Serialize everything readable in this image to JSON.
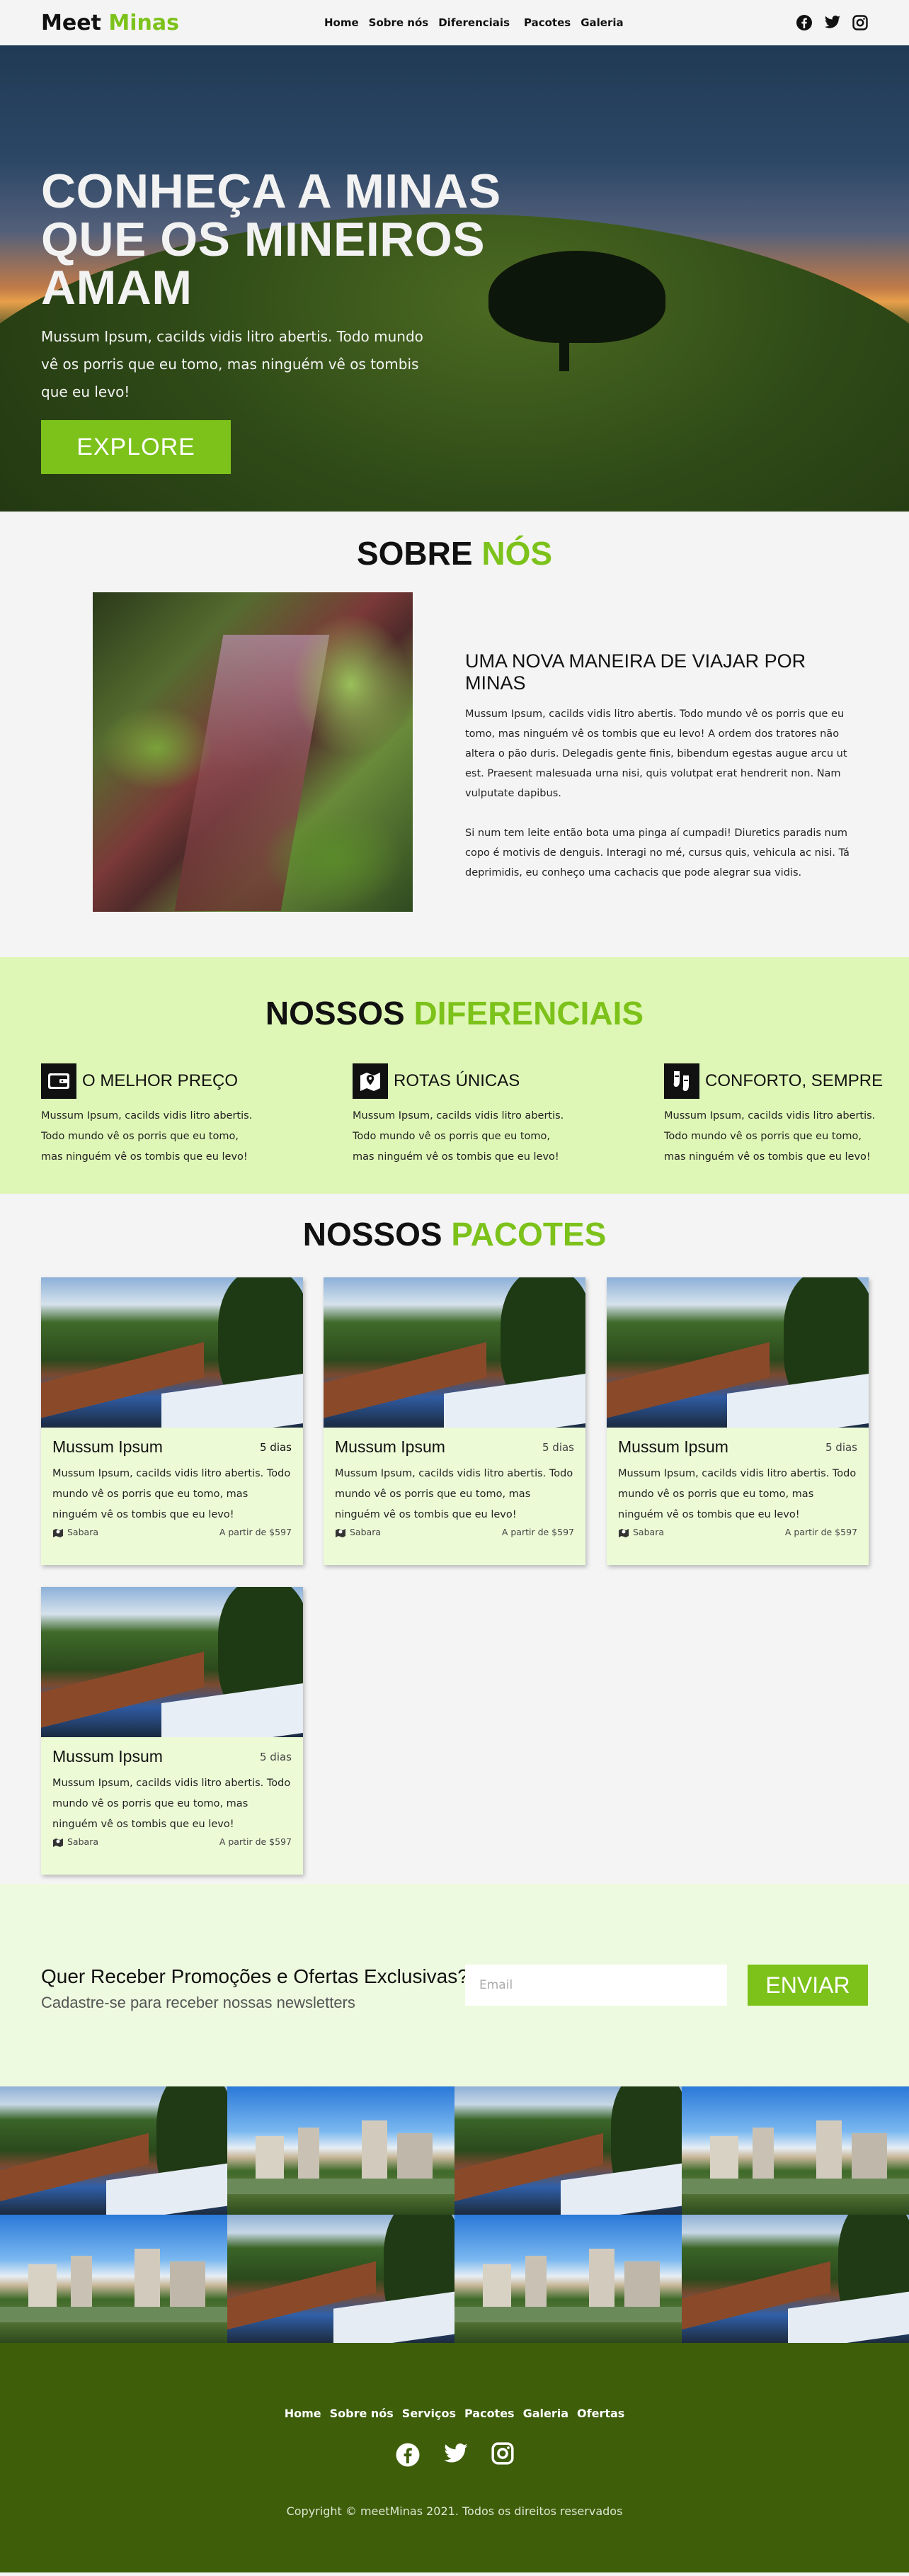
{
  "brand": {
    "name_part1": "Meet",
    "name_part2": "Minas",
    "accent_color": "#7cc21a"
  },
  "nav": {
    "items": [
      "Home",
      "Sobre nós",
      "Diferenciais",
      "Pacotes",
      "Galeria"
    ]
  },
  "social_icons": [
    "facebook-icon",
    "twitter-icon",
    "instagram-icon"
  ],
  "hero": {
    "title_line1": "CONHEÇA A MINAS",
    "title_line2": "QUE OS MINEIROS AMAM",
    "text": "Mussum Ipsum, cacilds vidis litro abertis. Todo mundo vê os porris que eu tomo, mas ninguém vê os tombis que eu levo!",
    "button": "EXPLORE"
  },
  "about": {
    "title_part1": "SOBRE",
    "title_part2": "NÓS",
    "subtitle": "UMA NOVA MANEIRA DE VIAJAR POR MINAS",
    "paragraph1": "Mussum Ipsum, cacilds vidis litro abertis. Todo mundo vê os porris que eu tomo, mas ninguém vê os tombis que eu levo! A ordem dos tratores não altera o pão duris. Delegadis gente finis, bibendum egestas augue arcu ut est. Praesent malesuada urna nisi, quis volutpat erat hendrerit non. Nam vulputate dapibus.",
    "paragraph2": "Si num tem leite então bota uma pinga aí cumpadi! Diuretics paradis num copo é motivis de denguis. Interagi no mé, cursus quis, vehicula ac nisi. Tá deprimidis, eu conheço uma cachacis que pode alegrar sua vidis."
  },
  "differentials": {
    "title_part1": "NOSSOS",
    "title_part2": "DIFERENCIAIS",
    "items": [
      {
        "icon": "wallet-icon",
        "title": "O MELHOR PREÇO",
        "text": "Mussum Ipsum, cacilds vidis litro abertis. Todo mundo vê os porris que eu tomo, mas ninguém vê os tombis que eu levo!"
      },
      {
        "icon": "map-pin-icon",
        "title": "ROTAS ÚNICAS",
        "text": "Mussum Ipsum, cacilds vidis litro abertis. Todo mundo vê os porris que eu tomo, mas ninguém vê os tombis que eu levo!"
      },
      {
        "icon": "shoes-icon",
        "title": "CONFORTO, SEMPRE",
        "text": "Mussum Ipsum, cacilds vidis litro abertis. Todo mundo vê os porris que eu tomo, mas ninguém vê os tombis que eu levo!"
      }
    ]
  },
  "packages": {
    "title_part1": "NOSSOS",
    "title_part2": "PACOTES",
    "cards": [
      {
        "name": "Mussum Ipsum",
        "days": "5 dias",
        "text": "Mussum Ipsum, cacilds vidis litro abertis. Todo mundo vê os porris que eu tomo, mas ninguém vê os tombis que eu levo!",
        "location": "Sabara",
        "price": "A partir de $597"
      },
      {
        "name": "Mussum Ipsum",
        "days": "5 dias",
        "text": "Mussum Ipsum, cacilds vidis litro abertis. Todo mundo vê os porris que eu tomo, mas ninguém vê os tombis que eu levo!",
        "location": "Sabara",
        "price": "A partir de $597"
      },
      {
        "name": "Mussum Ipsum",
        "days": "5 dias",
        "text": "Mussum Ipsum, cacilds vidis litro abertis. Todo mundo vê os porris que eu tomo, mas ninguém vê os tombis que eu levo!",
        "location": "Sabara",
        "price": "A partir de $597"
      },
      {
        "name": "Mussum Ipsum",
        "days": "5 dias",
        "text": "Mussum Ipsum, cacilds vidis litro abertis. Todo mundo vê os porris que eu tomo, mas ninguém vê os tombis que eu levo!",
        "location": "Sabara",
        "price": "A partir de $597"
      }
    ]
  },
  "newsletter": {
    "question": "Quer Receber Promoções e Ofertas Exclusivas?",
    "subtitle": "Cadastre-se para receber nossas newsletters",
    "email_placeholder": "Email",
    "button": "ENVIAR"
  },
  "gallery": {
    "tiles": [
      "town",
      "city",
      "town",
      "city",
      "city",
      "town",
      "city",
      "town"
    ]
  },
  "footer": {
    "nav": [
      "Home",
      "Sobre nós",
      "Serviços",
      "Pacotes",
      "Galeria",
      "Ofertas"
    ],
    "copyright": "Copyright © meetMinas 2021. Todos os direitos reservados"
  }
}
